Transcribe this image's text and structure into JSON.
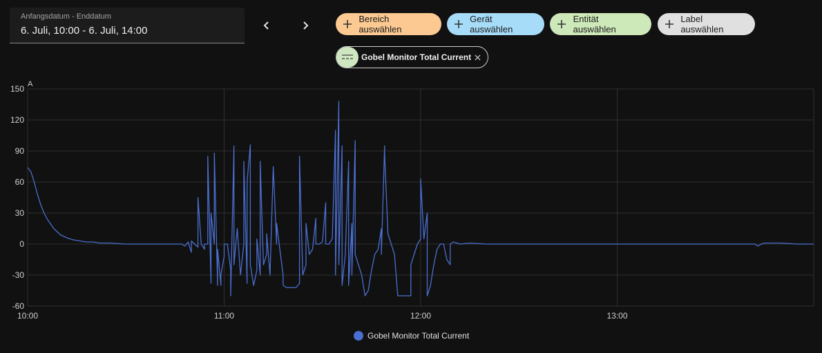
{
  "date_picker": {
    "label": "Anfangsdatum - Enddatum",
    "value": "6. Juli, 10:00 - 6. Juli, 14:00"
  },
  "nav": {
    "prev_icon": "chevron-left-icon",
    "next_icon": "chevron-right-icon"
  },
  "targets": [
    {
      "label": "Bereich auswählen",
      "color": "#fbc991",
      "icon": "plus-icon"
    },
    {
      "label": "Gerät auswählen",
      "color": "#a6dcf8",
      "icon": "plus-icon"
    },
    {
      "label": "Entität auswählen",
      "color": "#cde8b9",
      "icon": "plus-icon"
    },
    {
      "label": "Label auswählen",
      "color": "#e0e0e0",
      "icon": "plus-icon"
    }
  ],
  "selected_entity": {
    "label": "Gobel Monitor Total Current",
    "icon": "current-ac-dc-icon",
    "close_icon": "close-icon"
  },
  "chart_data": {
    "type": "line",
    "ylabel": "A",
    "ylim": [
      -60,
      150
    ],
    "yticks": [
      150,
      120,
      90,
      60,
      30,
      0,
      -30,
      -60
    ],
    "xticks": [
      "10:00",
      "11:00",
      "12:00",
      "13:00"
    ],
    "x_domain": [
      "10:00",
      "14:00"
    ],
    "grid": true,
    "legend": "bottom-center",
    "series": [
      {
        "name": "Gobel Monitor Total Current",
        "color": "#4a6fd0",
        "points": [
          [
            "10:00",
            74
          ],
          [
            "10:01",
            70
          ],
          [
            "10:02",
            60
          ],
          [
            "10:03",
            48
          ],
          [
            "10:04",
            38
          ],
          [
            "10:05",
            30
          ],
          [
            "10:06",
            24
          ],
          [
            "10:08",
            15
          ],
          [
            "10:10",
            9
          ],
          [
            "10:12",
            6
          ],
          [
            "10:14",
            4
          ],
          [
            "10:16",
            3
          ],
          [
            "10:18",
            2
          ],
          [
            "10:20",
            2
          ],
          [
            "10:22",
            1
          ],
          [
            "10:25",
            1
          ],
          [
            "10:30",
            0
          ],
          [
            "10:40",
            0
          ],
          [
            "10:47",
            0
          ],
          [
            "10:48",
            -2
          ],
          [
            "10:49",
            2
          ],
          [
            "10:50",
            -8
          ],
          [
            "10:50",
            3
          ],
          [
            "10:51",
            0
          ],
          [
            "10:52",
            -3
          ],
          [
            "10:52",
            45
          ],
          [
            "10:53",
            0
          ],
          [
            "10:54",
            -5
          ],
          [
            "10:54",
            0
          ],
          [
            "10:55",
            0
          ],
          [
            "10:55",
            85
          ],
          [
            "10:56",
            -38
          ],
          [
            "10:56",
            30
          ],
          [
            "10:57",
            0
          ],
          [
            "10:57",
            88
          ],
          [
            "10:58",
            -40
          ],
          [
            "10:58",
            -5
          ],
          [
            "10:59",
            -40
          ],
          [
            "10:59",
            -30
          ],
          [
            "11:00",
            -12
          ],
          [
            "11:00",
            0
          ],
          [
            "11:01",
            0
          ],
          [
            "11:02",
            -25
          ],
          [
            "11:02",
            -50
          ],
          [
            "11:03",
            95
          ],
          [
            "11:03",
            -20
          ],
          [
            "11:04",
            15
          ],
          [
            "11:05",
            -30
          ],
          [
            "11:06",
            0
          ],
          [
            "11:06",
            80
          ],
          [
            "11:07",
            -38
          ],
          [
            "11:07",
            60
          ],
          [
            "11:08",
            96
          ],
          [
            "11:08",
            -20
          ],
          [
            "11:09",
            -40
          ],
          [
            "11:10",
            -25
          ],
          [
            "11:10",
            5
          ],
          [
            "11:11",
            -30
          ],
          [
            "11:11",
            80
          ],
          [
            "11:12",
            -20
          ],
          [
            "11:13",
            -10
          ],
          [
            "11:13",
            10
          ],
          [
            "11:14",
            -30
          ],
          [
            "11:15",
            75
          ],
          [
            "11:16",
            0
          ],
          [
            "11:16",
            20
          ],
          [
            "11:17",
            -5
          ],
          [
            "11:18",
            -30
          ],
          [
            "11:18",
            -40
          ],
          [
            "11:19",
            -42
          ],
          [
            "11:20",
            -42
          ],
          [
            "11:22",
            -42
          ],
          [
            "11:23",
            -38
          ],
          [
            "11:23",
            85
          ],
          [
            "11:24",
            -30
          ],
          [
            "11:25",
            -20
          ],
          [
            "11:25",
            20
          ],
          [
            "11:26",
            -10
          ],
          [
            "11:27",
            -5
          ],
          [
            "11:28",
            25
          ],
          [
            "11:28",
            0
          ],
          [
            "11:29",
            0
          ],
          [
            "11:30",
            2
          ],
          [
            "11:31",
            40
          ],
          [
            "11:31",
            0
          ],
          [
            "11:32",
            0
          ],
          [
            "11:33",
            5
          ],
          [
            "11:34",
            110
          ],
          [
            "11:34",
            -30
          ],
          [
            "11:35",
            138
          ],
          [
            "11:35",
            -20
          ],
          [
            "11:36",
            95
          ],
          [
            "11:36",
            -40
          ],
          [
            "11:37",
            -10
          ],
          [
            "11:38",
            80
          ],
          [
            "11:38",
            -40
          ],
          [
            "11:39",
            20
          ],
          [
            "11:39",
            -30
          ],
          [
            "11:40",
            100
          ],
          [
            "11:40",
            -10
          ],
          [
            "11:41",
            -20
          ],
          [
            "11:42",
            -30
          ],
          [
            "11:43",
            -50
          ],
          [
            "11:44",
            -45
          ],
          [
            "11:45",
            -25
          ],
          [
            "11:46",
            -10
          ],
          [
            "11:47",
            -5
          ],
          [
            "11:48",
            15
          ],
          [
            "11:48",
            -10
          ],
          [
            "11:49",
            95
          ],
          [
            "11:49",
            88
          ],
          [
            "11:50",
            10
          ],
          [
            "11:51",
            0
          ],
          [
            "11:52",
            -10
          ],
          [
            "11:53",
            -50
          ],
          [
            "11:54",
            -50
          ],
          [
            "11:56",
            -50
          ],
          [
            "11:57",
            -50
          ],
          [
            "11:57",
            -20
          ],
          [
            "11:58",
            -10
          ],
          [
            "11:59",
            0
          ],
          [
            "11:59",
            0
          ],
          [
            "12:00",
            5
          ],
          [
            "12:00",
            63
          ],
          [
            "12:01",
            5
          ],
          [
            "12:02",
            30
          ],
          [
            "12:02",
            -50
          ],
          [
            "12:03",
            -40
          ],
          [
            "12:04",
            -20
          ],
          [
            "12:05",
            -5
          ],
          [
            "12:06",
            0
          ],
          [
            "12:07",
            0
          ],
          [
            "12:08",
            -15
          ],
          [
            "12:09",
            -20
          ],
          [
            "12:09",
            0
          ],
          [
            "12:10",
            2
          ],
          [
            "12:12",
            0
          ],
          [
            "12:15",
            1
          ],
          [
            "12:20",
            0
          ],
          [
            "12:30",
            0
          ],
          [
            "12:40",
            0
          ],
          [
            "13:00",
            0
          ],
          [
            "13:30",
            0
          ],
          [
            "13:42",
            0
          ],
          [
            "13:43",
            -2
          ],
          [
            "13:44",
            0
          ],
          [
            "13:45",
            1
          ],
          [
            "13:50",
            1
          ],
          [
            "13:55",
            0
          ],
          [
            "14:00",
            0
          ]
        ]
      }
    ]
  }
}
